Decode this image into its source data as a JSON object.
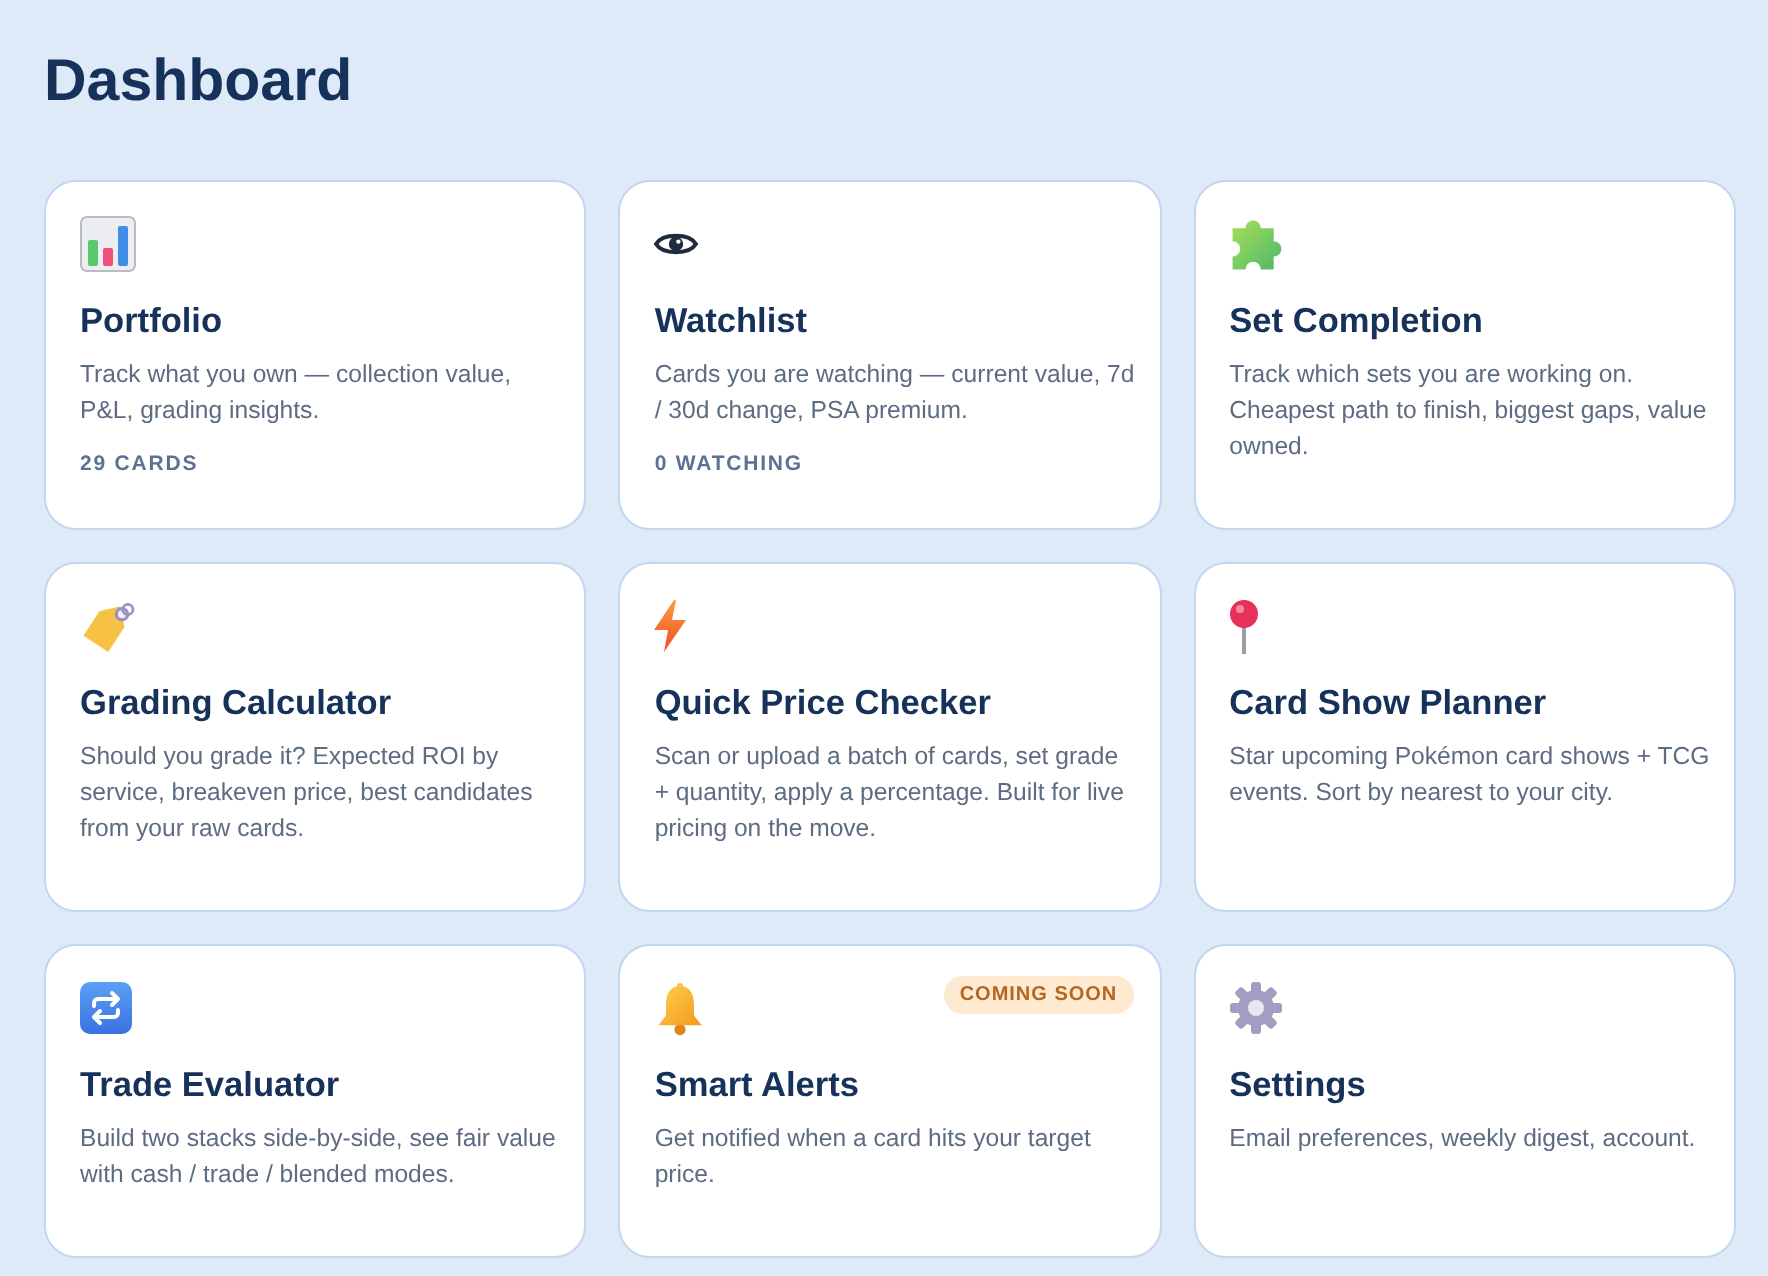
{
  "page": {
    "title": "Dashboard"
  },
  "rows": [
    {
      "cards": [
        {
          "title": "Portfolio",
          "description": "Track what you own — collection value, P&L, grading insights.",
          "meta": "29 CARDS"
        },
        {
          "title": "Watchlist",
          "description": "Cards you are watching — current value, 7d / 30d change, PSA premium.",
          "meta": "0 WATCHING"
        },
        {
          "title": "Set Completion",
          "description": "Track which sets you are working on. Cheapest path to finish, biggest gaps, value owned."
        }
      ]
    },
    {
      "cards": [
        {
          "title": "Grading Calculator",
          "description": "Should you grade it? Expected ROI by service, breakeven price, best candidates from your raw cards."
        },
        {
          "title": "Quick Price Checker",
          "description": "Scan or upload a batch of cards, set grade + quantity, apply a percentage. Built for live pricing on the move."
        },
        {
          "title": "Card Show Planner",
          "description": "Star upcoming Pokémon card shows + TCG events. Sort by nearest to your city."
        }
      ]
    },
    {
      "cards": [
        {
          "title": "Trade Evaluator",
          "description": "Build two stacks side-by-side, see fair value with cash / trade / blended modes."
        },
        {
          "title": "Smart Alerts",
          "description": "Get notified when a card hits your target price.",
          "badge": "COMING SOON"
        },
        {
          "title": "Settings",
          "description": "Email preferences, weekly digest, account."
        }
      ]
    }
  ]
}
